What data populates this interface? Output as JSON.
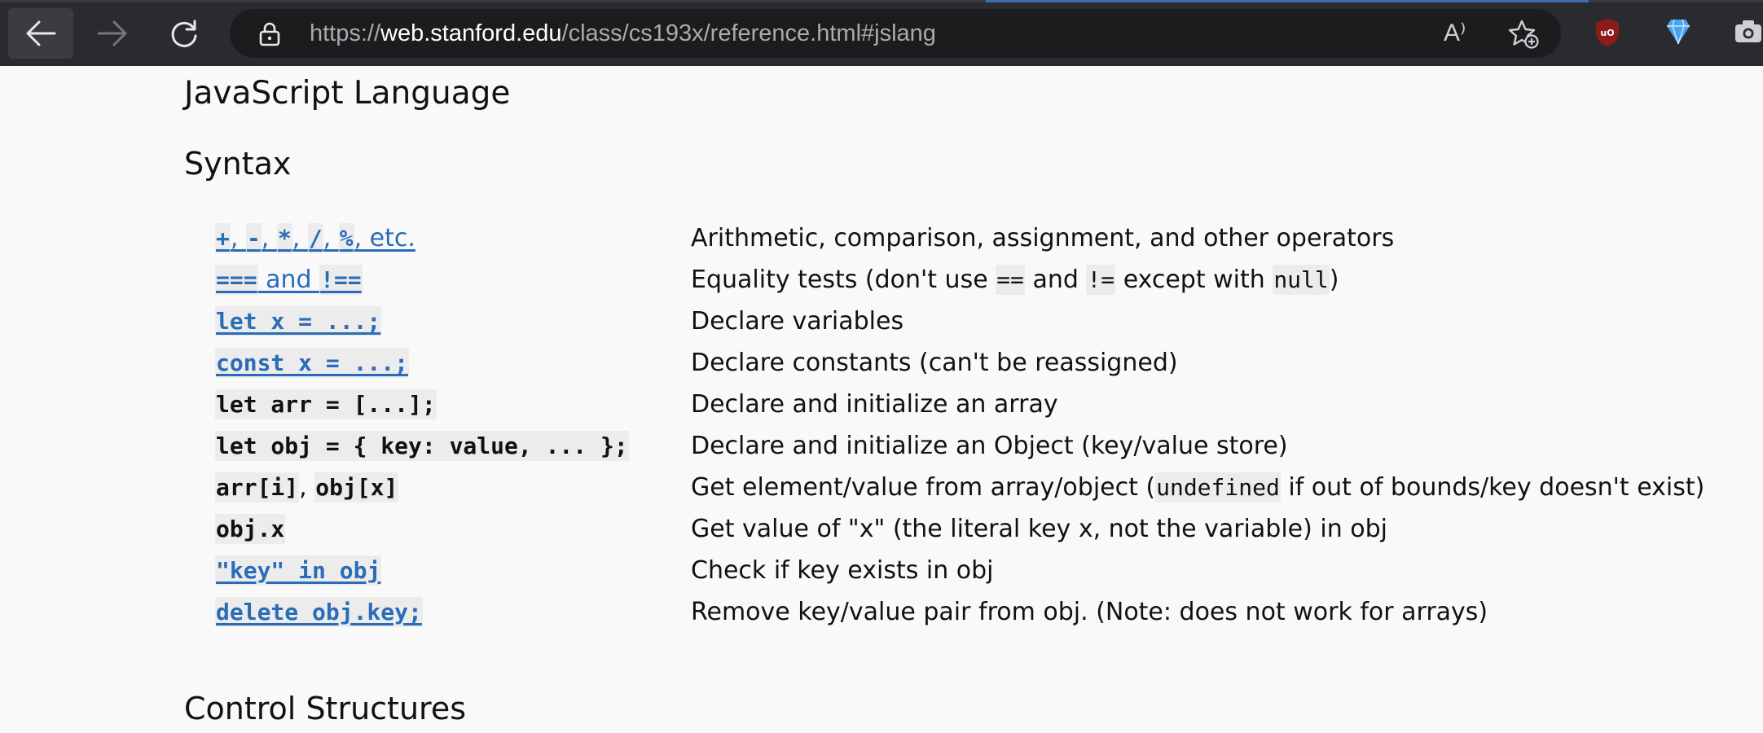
{
  "browser": {
    "url_scheme": "https://",
    "url_host": "web.stanford.edu",
    "url_path": "/class/cs193x/reference.html#jslang",
    "read_aloud_label": "A⁾",
    "colors": {
      "chrome": "#2a2b2e",
      "urlbar": "#1b1c1e",
      "accent": "#3d6db3"
    }
  },
  "page": {
    "title": "JavaScript Language",
    "sections": {
      "syntax": "Syntax",
      "control": "Control Structures"
    },
    "link_color": "#2a6cb8",
    "rows": [
      {
        "code_parts": [
          "+",
          ", ",
          "-",
          ", ",
          "*",
          ", ",
          "/",
          ", ",
          "%",
          ", etc."
        ],
        "link": true,
        "desc": [
          "Arithmetic, comparison, assignment, and other operators"
        ]
      },
      {
        "code_parts": [
          "===",
          " and ",
          "!=="
        ],
        "link": true,
        "desc": [
          "Equality tests (don't use ",
          "==",
          " and ",
          "!=",
          " except with ",
          "null",
          ")"
        ]
      },
      {
        "code_parts": [
          "let x = ...;"
        ],
        "link": true,
        "desc": [
          "Declare variables"
        ]
      },
      {
        "code_parts": [
          "const x = ...;"
        ],
        "link": true,
        "desc": [
          "Declare constants (can't be reassigned)"
        ]
      },
      {
        "code_parts": [
          "let arr = [...];"
        ],
        "link": false,
        "desc": [
          "Declare and initialize an array"
        ]
      },
      {
        "code_parts": [
          "let obj = { key: value, ... };"
        ],
        "link": false,
        "desc": [
          "Declare and initialize an Object (key/value store)"
        ]
      },
      {
        "code_parts": [
          "arr[i]",
          ", ",
          "obj[x]"
        ],
        "link": false,
        "desc": [
          "Get element/value from array/object (",
          "undefined",
          " if out of bounds/key doesn't exist)"
        ]
      },
      {
        "code_parts": [
          "obj.x"
        ],
        "link": false,
        "desc": [
          "Get value of \"x\" (the literal key x, not the variable) in obj"
        ]
      },
      {
        "code_parts": [
          "\"key\" in obj"
        ],
        "link": true,
        "desc": [
          "Check if key exists in obj"
        ]
      },
      {
        "code_parts": [
          "delete obj.key;"
        ],
        "link": true,
        "desc": [
          "Remove key/value pair from obj. (Note: does not work for arrays)"
        ]
      }
    ]
  }
}
